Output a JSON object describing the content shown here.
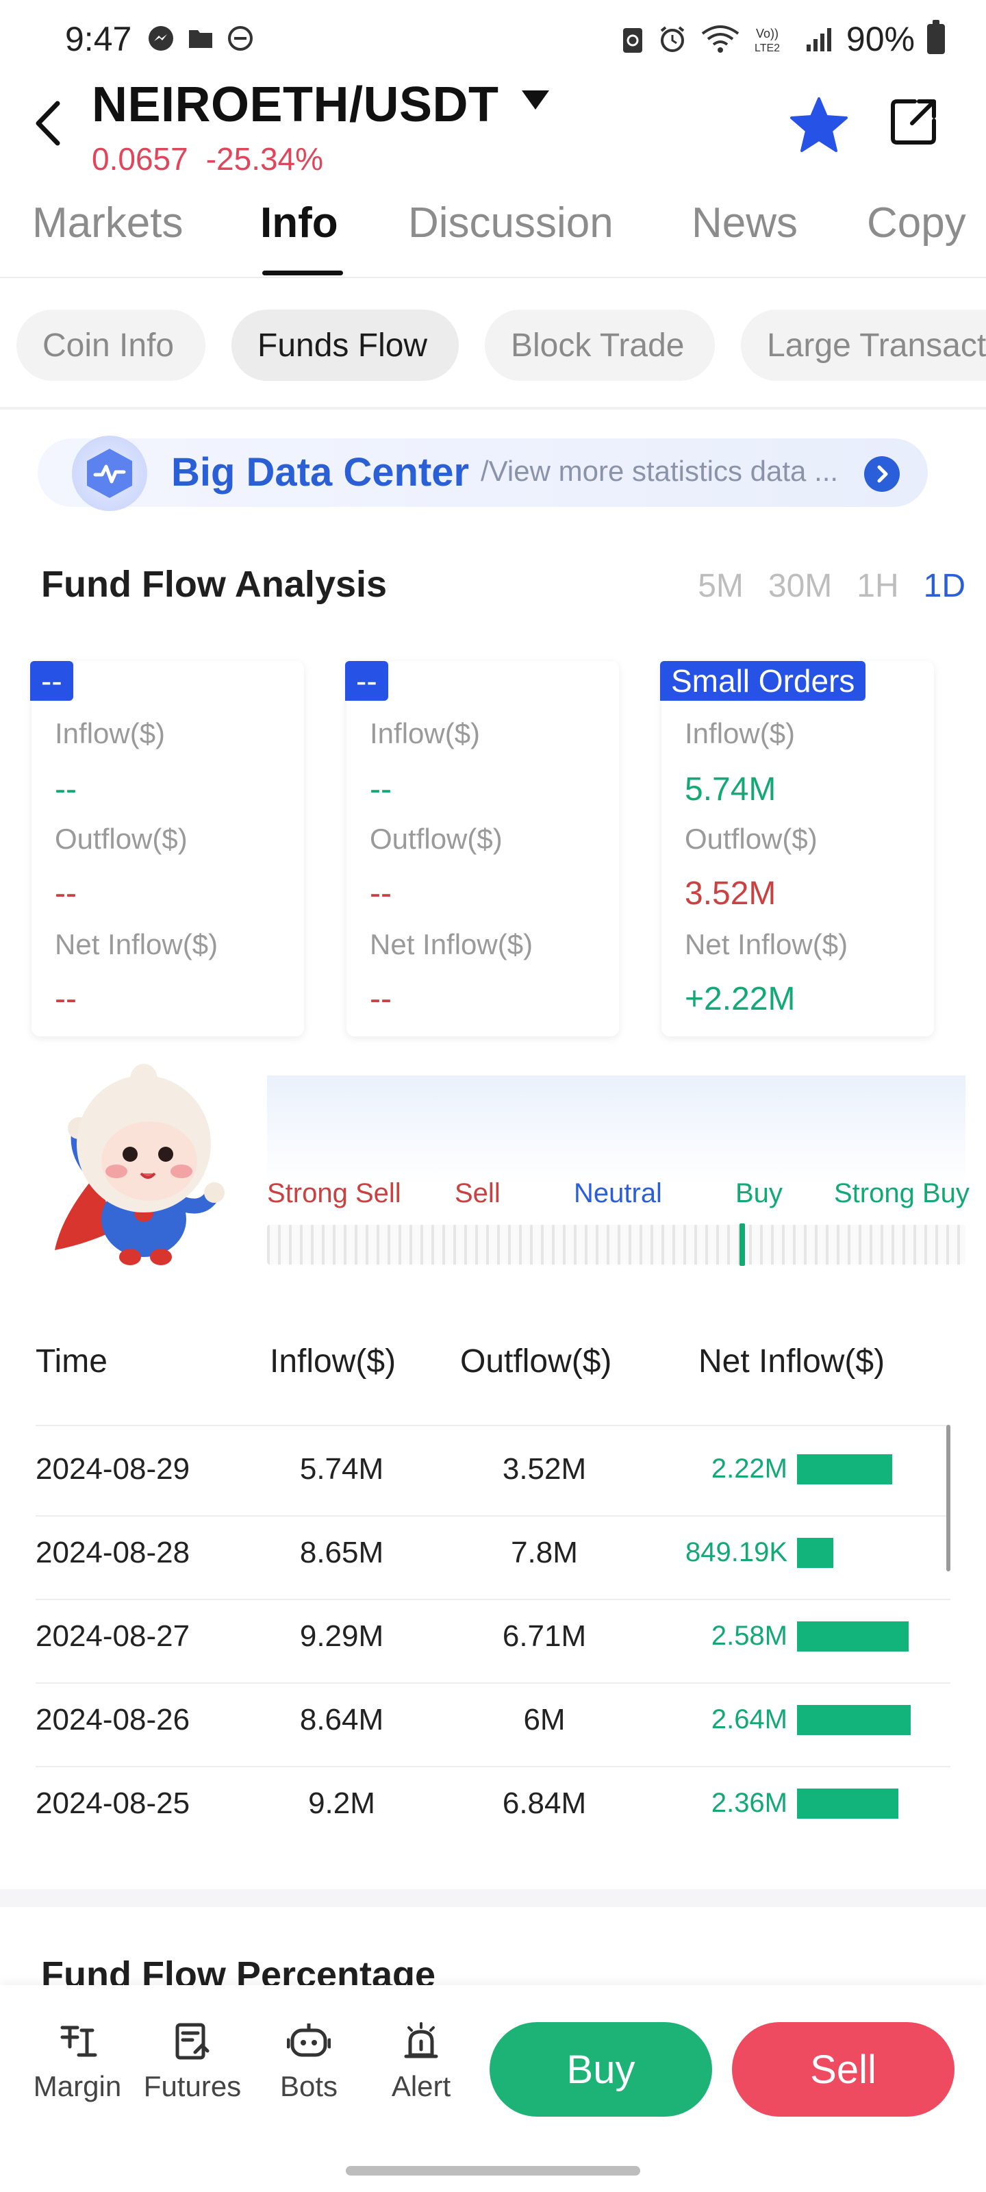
{
  "status_bar": {
    "time": "9:47",
    "battery": "90%"
  },
  "header": {
    "pair": "NEIROETH/USDT",
    "price": "0.0657",
    "change": "-25.34%"
  },
  "tabs": [
    "Markets",
    "Info",
    "Discussion",
    "News",
    "Copy"
  ],
  "subtabs": [
    "Coin Info",
    "Funds Flow",
    "Block Trade",
    "Large Transact"
  ],
  "banner": {
    "title": "Big Data Center",
    "subtitle": "/View more statistics data ..."
  },
  "fund_flow": {
    "title": "Fund Flow Analysis",
    "periods": [
      "5M",
      "30M",
      "1H",
      "1D"
    ],
    "active_period": "1D",
    "cards": [
      {
        "tag": "--",
        "inflow_label": "Inflow($)",
        "inflow": "--",
        "outflow_label": "Outflow($)",
        "outflow": "--",
        "net_label": "Net Inflow($)",
        "net": "--"
      },
      {
        "tag": "--",
        "inflow_label": "Inflow($)",
        "inflow": "--",
        "outflow_label": "Outflow($)",
        "outflow": "--",
        "net_label": "Net Inflow($)",
        "net": "--"
      },
      {
        "tag": "Small Orders",
        "inflow_label": "Inflow($)",
        "inflow": "5.74M",
        "outflow_label": "Outflow($)",
        "outflow": "3.52M",
        "net_label": "Net Inflow($)",
        "net": "+2.22M"
      }
    ],
    "sentiment": {
      "labels": [
        "Strong Sell",
        "Sell",
        "Neutral",
        "Buy",
        "Strong Buy"
      ],
      "level": 0.68
    }
  },
  "table": {
    "headers": [
      "Time",
      "Inflow($)",
      "Outflow($)",
      "Net Inflow($)"
    ],
    "rows": [
      {
        "time": "2024-08-29",
        "inflow": "5.74M",
        "outflow": "3.52M",
        "net": "2.22M",
        "bar_fraction": 0.84
      },
      {
        "time": "2024-08-28",
        "inflow": "8.65M",
        "outflow": "7.8M",
        "net": "849.19K",
        "bar_fraction": 0.32
      },
      {
        "time": "2024-08-27",
        "inflow": "9.29M",
        "outflow": "6.71M",
        "net": "2.58M",
        "bar_fraction": 0.98
      },
      {
        "time": "2024-08-26",
        "inflow": "8.64M",
        "outflow": "6M",
        "net": "2.64M",
        "bar_fraction": 1.0
      },
      {
        "time": "2024-08-25",
        "inflow": "9.2M",
        "outflow": "6.84M",
        "net": "2.36M",
        "bar_fraction": 0.89
      }
    ]
  },
  "section2": {
    "title": "Fund Flow Percentage"
  },
  "bottom_nav": {
    "items": [
      {
        "label": "Margin",
        "icon": "margin-icon"
      },
      {
        "label": "Futures",
        "icon": "futures-icon"
      },
      {
        "label": "Bots",
        "icon": "bots-icon"
      },
      {
        "label": "Alert",
        "icon": "alert-icon"
      }
    ],
    "buy": "Buy",
    "sell": "Sell"
  },
  "colors": {
    "accent": "#2a5fd9",
    "green": "#13a974",
    "red": "#c94141",
    "buy": "#1db377",
    "sell": "#ee4b61"
  }
}
